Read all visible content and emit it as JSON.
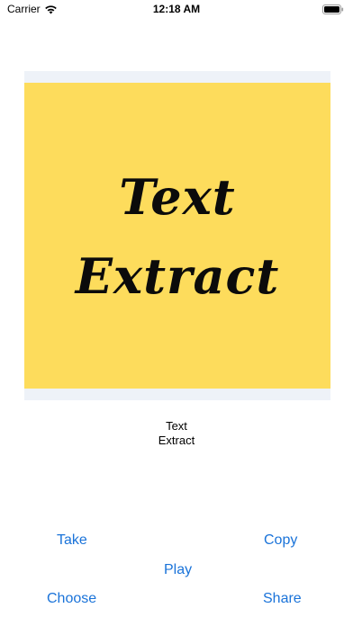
{
  "status_bar": {
    "carrier": "Carrier",
    "time": "12:18 AM",
    "icons": [
      "wifi-icon",
      "battery-icon"
    ]
  },
  "image_preview": {
    "line1": "Text",
    "line2": "Extract",
    "background_color": "#fddc5c",
    "frame_color": "#eef2f8"
  },
  "extracted_text": {
    "line1": "Text",
    "line2": "Extract"
  },
  "actions": {
    "take": "Take",
    "copy": "Copy",
    "play": "Play",
    "choose": "Choose",
    "share": "Share",
    "accent_color": "#1a73d9"
  }
}
